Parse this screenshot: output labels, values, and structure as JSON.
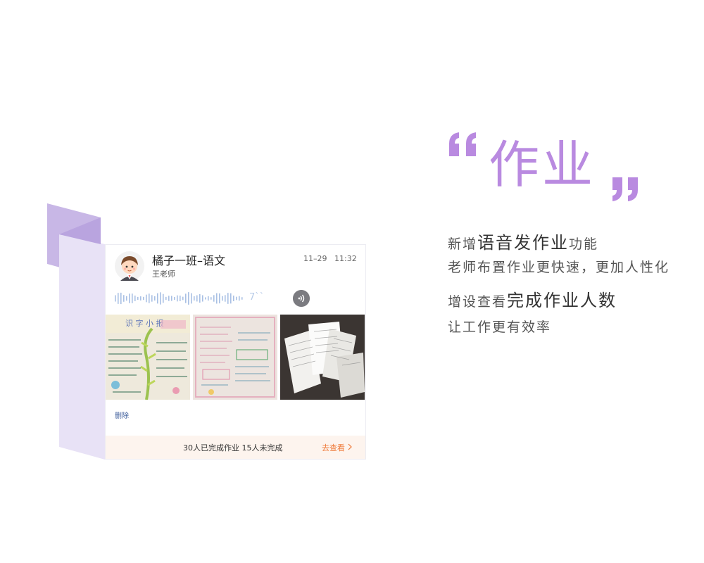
{
  "accent_color": "#b98ae0",
  "homework_card": {
    "class_name": "橘子一班–语文",
    "teacher": "王老师",
    "date": "11–29",
    "time": "11:32",
    "voice_duration": "7``",
    "delete_label": "删除",
    "completion_text": "30人已完成作业 15人未完成",
    "view_label": "去查看",
    "photos": [
      "homework-photo-1",
      "homework-photo-2",
      "homework-photo-3"
    ]
  },
  "promo": {
    "title": "作业",
    "line1_prefix": "新增",
    "line1_highlight": "语音发作业",
    "line1_suffix": "功能",
    "line2": "老师布置作业更快速，更加人性化",
    "line3_prefix": "增设查看",
    "line3_highlight": "完成作业人数",
    "line4": "让工作更有效率"
  }
}
